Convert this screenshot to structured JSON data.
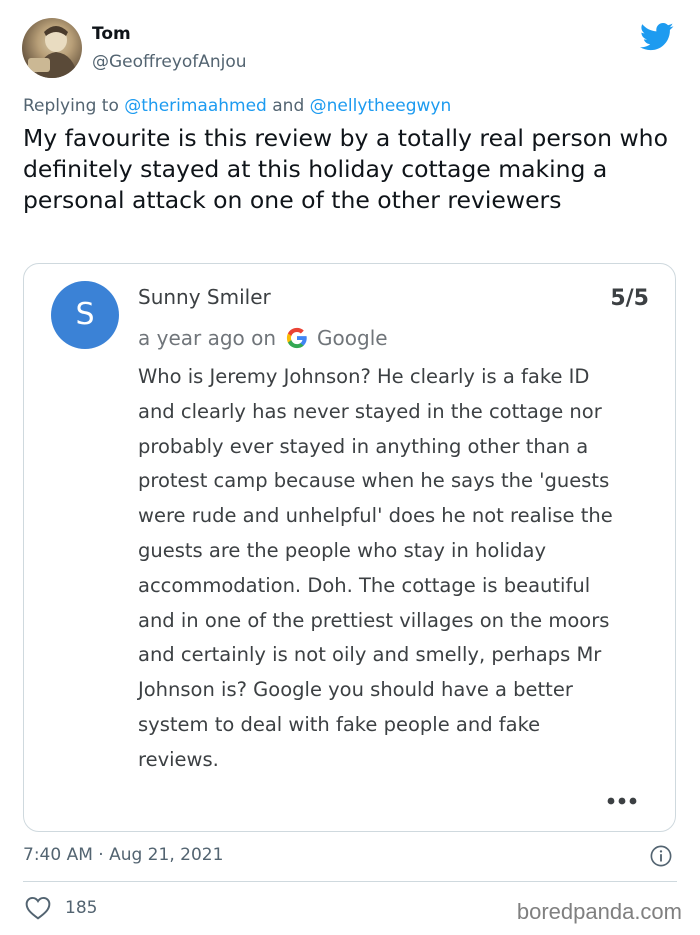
{
  "tweet": {
    "author_name": "Tom",
    "author_handle": "@GeoffreyofAnjou",
    "reply_prefix": "Replying to",
    "reply_mention_1": "@therimaahmed",
    "reply_and": "and",
    "reply_mention_2": "@nellytheegwyn",
    "text": "My favourite is this review by a totally real person who definitely stayed at this holiday cottage making a personal attack on one of the other reviewers",
    "timestamp": "7:40 AM · Aug 21, 2021",
    "like_count": "185"
  },
  "review": {
    "avatar_letter": "S",
    "reviewer_name": "Sunny Smiler",
    "score": "5/5",
    "time_ago": "a year ago on",
    "source": "Google",
    "body": "Who is Jeremy Johnson? He clearly is a fake ID and clearly has never stayed in the cottage nor probably ever stayed in anything other than a protest camp because when he says the 'guests were rude and unhelpful' does he not realise the guests are the people who stay in holiday accommodation. Doh. The cottage is beautiful and in one of the prettiest villages on the moors and certainly is not oily and smelly, perhaps Mr Johnson is? Google you should have a better system to deal with fake people and fake reviews."
  },
  "watermark": "boredpanda.com",
  "colors": {
    "twitter_blue": "#1d9bf0",
    "reviewer_avatar": "#3b82d6",
    "secondary_text": "#536471"
  },
  "icons": {
    "brand": "twitter-bird-icon",
    "review_source": "google-g-icon",
    "more": "more-dots-icon",
    "info": "info-icon",
    "like": "heart-icon"
  }
}
